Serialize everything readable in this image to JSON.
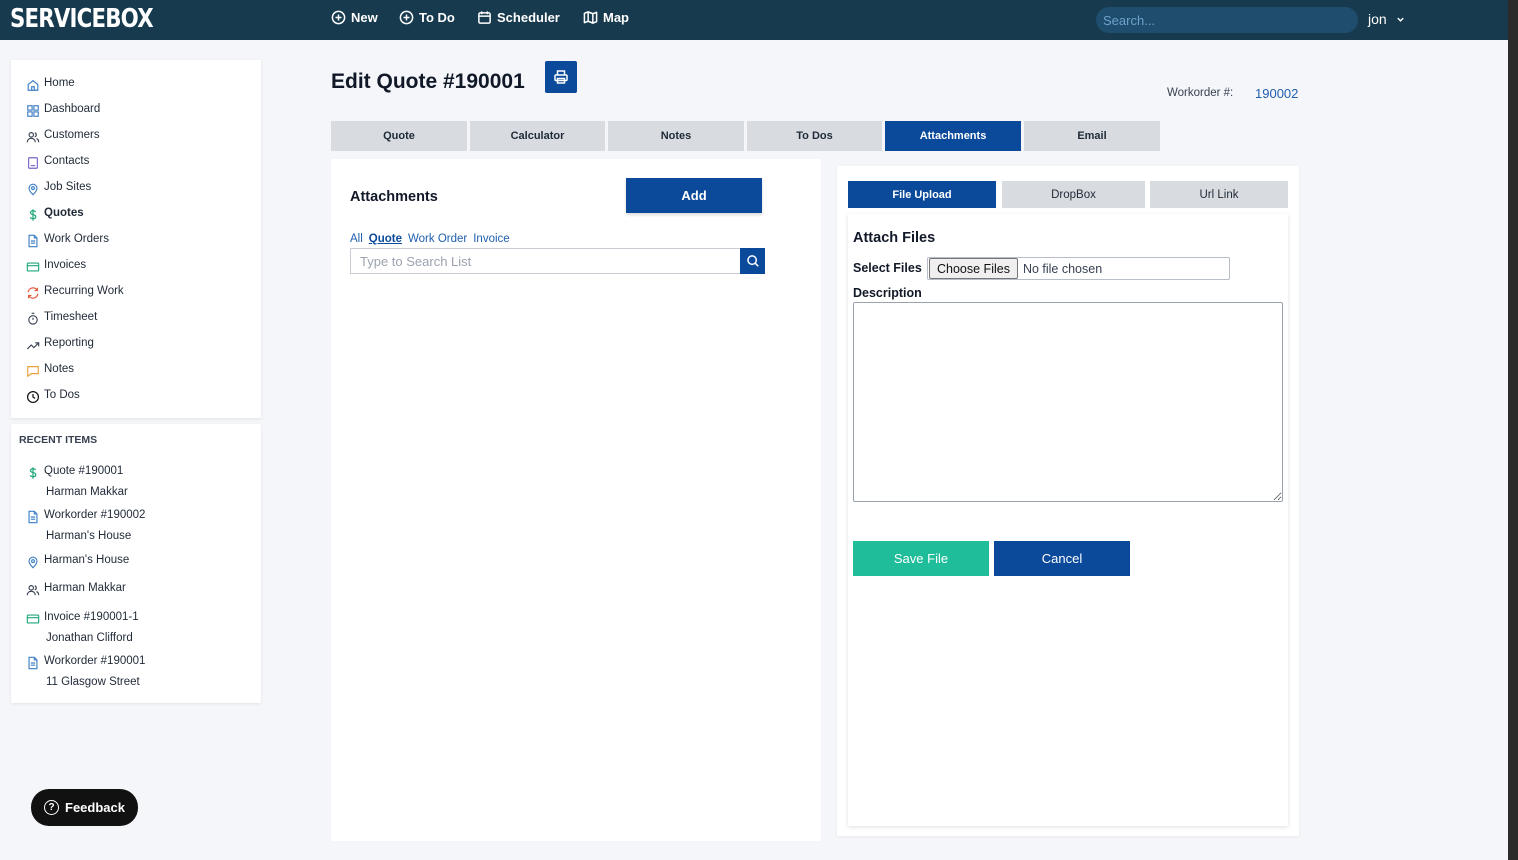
{
  "topbar": {
    "logo": "SERVICEBOX",
    "nav": [
      {
        "label": "New",
        "icon": "plus-circle-icon"
      },
      {
        "label": "To Do",
        "icon": "plus-circle-icon"
      },
      {
        "label": "Scheduler",
        "icon": "calendar-icon"
      },
      {
        "label": "Map",
        "icon": "map-icon"
      }
    ],
    "search_placeholder": "Search...",
    "user": "jon"
  },
  "sidebar": {
    "items": [
      {
        "label": "Home",
        "icon": "home-icon"
      },
      {
        "label": "Dashboard",
        "icon": "dashboard-icon"
      },
      {
        "label": "Customers",
        "icon": "users-icon"
      },
      {
        "label": "Contacts",
        "icon": "contact-card-icon"
      },
      {
        "label": "Job Sites",
        "icon": "location-pin-icon"
      },
      {
        "label": "Quotes",
        "icon": "dollar-icon",
        "active": true
      },
      {
        "label": "Work Orders",
        "icon": "document-icon"
      },
      {
        "label": "Invoices",
        "icon": "credit-card-icon"
      },
      {
        "label": "Recurring Work",
        "icon": "recurring-icon"
      },
      {
        "label": "Timesheet",
        "icon": "stopwatch-icon"
      },
      {
        "label": "Reporting",
        "icon": "trend-icon"
      },
      {
        "label": "Notes",
        "icon": "comment-icon"
      },
      {
        "label": "To Dos",
        "icon": "clock-icon"
      }
    ]
  },
  "recent": {
    "title": "RECENT ITEMS",
    "items": [
      {
        "line1": "Quote #190001",
        "line2": "Harman Makkar",
        "icon": "dollar-icon"
      },
      {
        "line1": "Workorder #190002",
        "line2": "Harman's House",
        "icon": "document-icon"
      },
      {
        "line1": "Harman's House",
        "line2": "",
        "icon": "location-pin-icon"
      },
      {
        "line1": "Harman Makkar",
        "line2": "",
        "icon": "users-icon"
      },
      {
        "line1": "Invoice #190001-1",
        "line2": "Jonathan Clifford",
        "icon": "credit-card-icon"
      },
      {
        "line1": "Workorder #190001",
        "line2": "11 Glasgow Street",
        "icon": "document-icon"
      }
    ]
  },
  "feedback": {
    "label": "Feedback"
  },
  "header": {
    "title": "Edit Quote #190001",
    "workorder_label": "Workorder #:",
    "workorder_value": "190002"
  },
  "tabs": [
    {
      "label": "Quote"
    },
    {
      "label": "Calculator"
    },
    {
      "label": "Notes"
    },
    {
      "label": "To Dos"
    },
    {
      "label": "Attachments",
      "active": true
    },
    {
      "label": "Email"
    }
  ],
  "attachments": {
    "title": "Attachments",
    "add_label": "Add",
    "filters": [
      "All",
      "Quote",
      "Work Order",
      "Invoice"
    ],
    "selected_filter": "Quote",
    "search_placeholder": "Type to Search List"
  },
  "upload": {
    "subtabs": [
      {
        "label": "File Upload",
        "active": true
      },
      {
        "label": "DropBox"
      },
      {
        "label": "Url Link"
      }
    ],
    "title": "Attach Files",
    "select_label": "Select Files",
    "choose_label": "Choose Files",
    "no_file": "No file chosen",
    "description_label": "Description",
    "description_value": "",
    "save_label": "Save File",
    "cancel_label": "Cancel"
  },
  "colors": {
    "topbar": "#173a4e",
    "primary": "#0b4a9b",
    "save": "#20bd9a",
    "tab_inactive": "#d8dbe0",
    "link": "#1f5fae"
  }
}
